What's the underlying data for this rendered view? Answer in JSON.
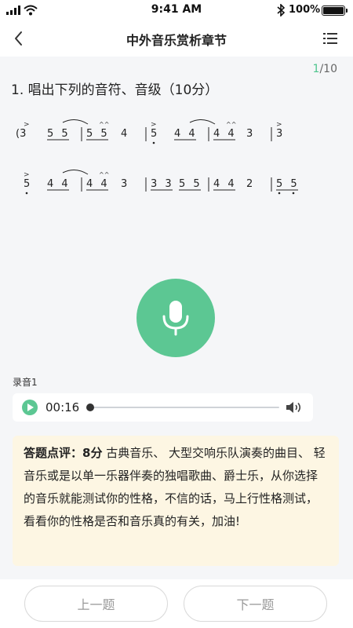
{
  "status_bar": {
    "time": "9:41 AM",
    "battery": "100%"
  },
  "nav": {
    "title": "中外音乐赏析章节"
  },
  "counter": {
    "current": "1",
    "total": "/10"
  },
  "question": {
    "text": "1. 唱出下列的音符、音级（10分）"
  },
  "notation": {
    "row1": {
      "bar_a": [
        "(3",
        "5 5",
        "5 5",
        "4"
      ],
      "bar_b": [
        "5",
        "4 4",
        "4 4",
        "3"
      ],
      "bar_c": [
        "3"
      ]
    },
    "row2": {
      "bar_a": [
        "5",
        "4 4",
        "4 4",
        "3"
      ],
      "bar_b": [
        "3 3",
        "5 5",
        "4 4",
        "2"
      ],
      "bar_c": [
        "5 5"
      ]
    }
  },
  "recording": {
    "label": "录音1",
    "time": "00:16",
    "progress": 0
  },
  "review": {
    "label": "答题点评：",
    "score": "8分",
    "text": "古典音乐、 大型交响乐队演奏的曲目、 轻音乐或是以单一乐器伴奏的独唱歌曲、爵士乐，从你选择的音乐就能测试你的性格，不信的话，马上行性格测试，看看你的性格是否和音乐真的有关，加油!"
  },
  "footer": {
    "prev_label": "上一题",
    "next_label": "下一题"
  },
  "colors": {
    "accent": "#5cc793",
    "review_bg": "#fdf6e3",
    "page_bg": "#f5f6f8"
  },
  "icons": {
    "back": "chevron-left-icon",
    "menu": "list-menu-icon",
    "mic": "microphone-icon",
    "play": "play-icon",
    "volume": "speaker-icon"
  }
}
